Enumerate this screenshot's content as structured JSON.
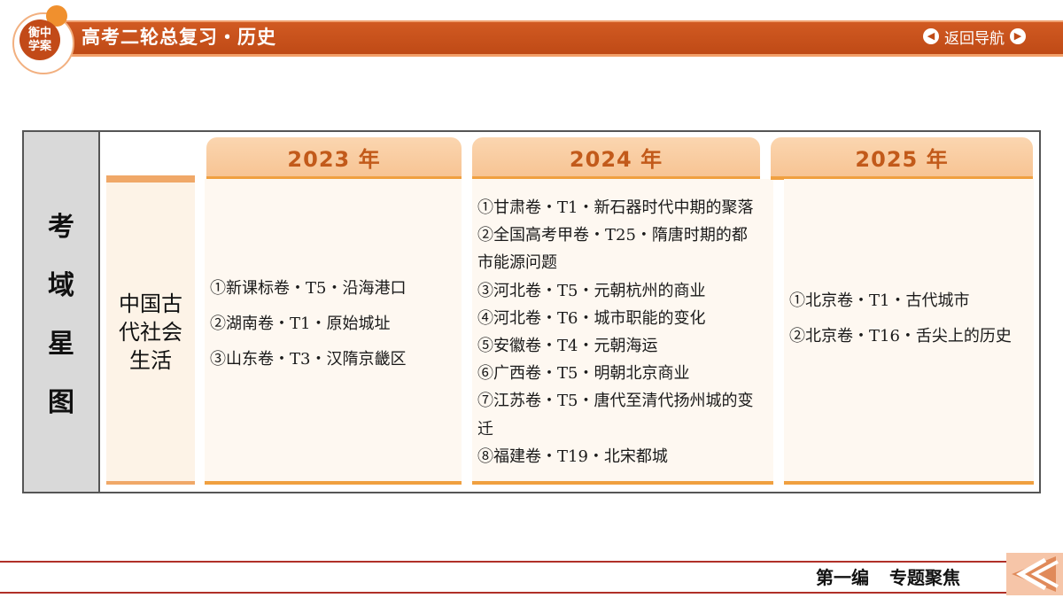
{
  "header": {
    "logo_text": "衡中学案",
    "title": "高考二轮总复习・历史",
    "nav_back_label": "返回导航"
  },
  "panel": {
    "side_label": [
      "考",
      "域",
      "星",
      "图"
    ],
    "topic": "中国古代社会生活",
    "columns": [
      {
        "year": "2023 年",
        "items": [
          "①新课标卷・T5・沿海港口",
          "②湖南卷・T1・原始城址",
          "③山东卷・T3・汉隋京畿区"
        ]
      },
      {
        "year": "2024 年",
        "items": [
          "①甘肃卷・T1・新石器时代中期的聚落",
          "②全国高考甲卷・T25・隋唐时期的都市能源问题",
          "③河北卷・T5・元朝杭州的商业",
          "④河北卷・T6・城市职能的变化",
          "⑤安徽卷・T4・元朝海运",
          "⑥广西卷・T5・明朝北京商业",
          "⑦江苏卷・T5・唐代至清代扬州城的变迁",
          "⑧福建卷・T19・北宋都城"
        ]
      },
      {
        "year": "2025 年",
        "items": [
          "①北京卷・T1・古代城市",
          "②北京卷・T16・舌尖上的历史"
        ]
      }
    ]
  },
  "footer": {
    "section_label": "第一编 专题聚焦"
  },
  "colors": {
    "header_bg": "#c24a18",
    "accent_orange": "#f0a040",
    "tab_text": "#c25a1a",
    "footer_line": "#b03028"
  }
}
